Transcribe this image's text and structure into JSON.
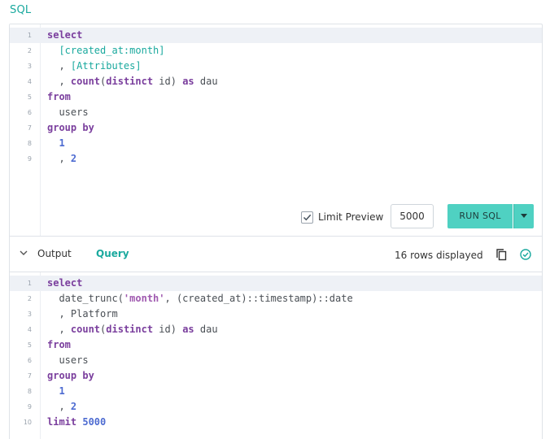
{
  "sql_heading": "SQL",
  "editor": {
    "lines": [
      {
        "n": "1",
        "tokens": [
          {
            "t": "select",
            "c": "kw"
          }
        ]
      },
      {
        "n": "2",
        "tokens": [
          {
            "t": "  "
          },
          {
            "t": "[created_at:month]",
            "c": "par"
          }
        ]
      },
      {
        "n": "3",
        "tokens": [
          {
            "t": "  , "
          },
          {
            "t": "[Attributes]",
            "c": "par"
          }
        ]
      },
      {
        "n": "4",
        "tokens": [
          {
            "t": "  , "
          },
          {
            "t": "count",
            "c": "kw"
          },
          {
            "t": "("
          },
          {
            "t": "distinct",
            "c": "kw"
          },
          {
            "t": " id) "
          },
          {
            "t": "as",
            "c": "kw"
          },
          {
            "t": " dau"
          }
        ]
      },
      {
        "n": "5",
        "tokens": [
          {
            "t": "from",
            "c": "kw"
          }
        ]
      },
      {
        "n": "6",
        "tokens": [
          {
            "t": "  users"
          }
        ]
      },
      {
        "n": "7",
        "tokens": [
          {
            "t": "group by",
            "c": "kw"
          }
        ]
      },
      {
        "n": "8",
        "tokens": [
          {
            "t": "  "
          },
          {
            "t": "1",
            "c": "num"
          }
        ]
      },
      {
        "n": "9",
        "tokens": [
          {
            "t": "  , "
          },
          {
            "t": "2",
            "c": "num"
          }
        ]
      }
    ],
    "active_line": 0
  },
  "controls": {
    "limit_preview_label": "Limit Preview",
    "limit_preview_checked": true,
    "limit_value": "5000",
    "run_label": "RUN SQL"
  },
  "output_bar": {
    "output_tab": "Output",
    "query_tab": "Query",
    "rows_displayed": "16 rows displayed"
  },
  "output_editor": {
    "lines": [
      {
        "n": "1",
        "tokens": [
          {
            "t": "select",
            "c": "kw"
          }
        ]
      },
      {
        "n": "2",
        "tokens": [
          {
            "t": "  date_trunc("
          },
          {
            "t": "'month'",
            "c": "str"
          },
          {
            "t": ", (created_at)::timestamp)::date"
          }
        ]
      },
      {
        "n": "3",
        "tokens": [
          {
            "t": "  , Platform"
          }
        ]
      },
      {
        "n": "4",
        "tokens": [
          {
            "t": "  , "
          },
          {
            "t": "count",
            "c": "kw"
          },
          {
            "t": "("
          },
          {
            "t": "distinct",
            "c": "kw"
          },
          {
            "t": " id) "
          },
          {
            "t": "as",
            "c": "kw"
          },
          {
            "t": " dau"
          }
        ]
      },
      {
        "n": "5",
        "tokens": [
          {
            "t": "from",
            "c": "kw"
          }
        ]
      },
      {
        "n": "6",
        "tokens": [
          {
            "t": "  users"
          }
        ]
      },
      {
        "n": "7",
        "tokens": [
          {
            "t": "group by",
            "c": "kw"
          }
        ]
      },
      {
        "n": "8",
        "tokens": [
          {
            "t": "  "
          },
          {
            "t": "1",
            "c": "num"
          }
        ]
      },
      {
        "n": "9",
        "tokens": [
          {
            "t": "  , "
          },
          {
            "t": "2",
            "c": "num"
          }
        ]
      },
      {
        "n": "10",
        "tokens": [
          {
            "t": "limit",
            "c": "kw"
          },
          {
            "t": " "
          },
          {
            "t": "5000",
            "c": "num"
          }
        ]
      }
    ],
    "active_line": 0
  },
  "colors": {
    "accent": "#1aa99e",
    "run_button": "#4fd1c2",
    "keyword": "#7a3e9d",
    "number": "#4d6bd1",
    "active_line": "#eef1f6"
  },
  "icons": [
    "chevron-down-icon",
    "checkbox-check-icon",
    "dropdown-caret-icon",
    "copy-icon",
    "check-circle-icon"
  ]
}
